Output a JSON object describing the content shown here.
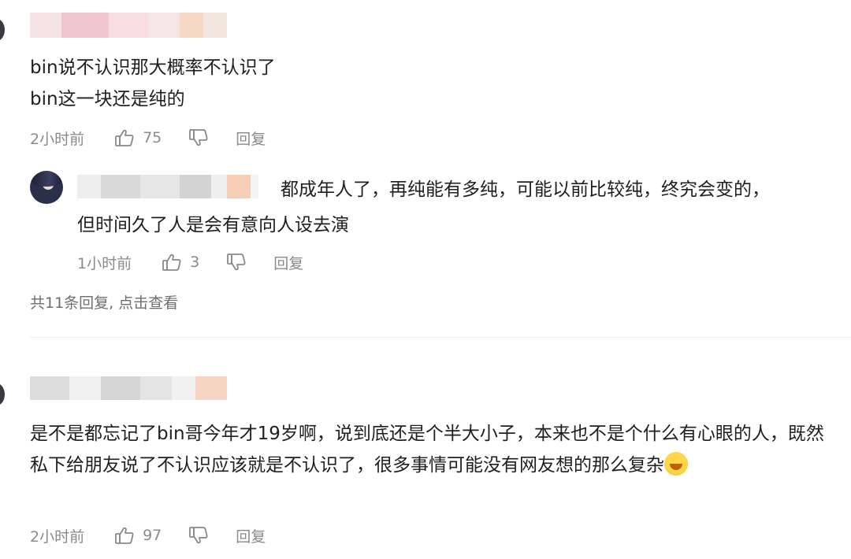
{
  "comments": [
    {
      "lines": [
        "bin说不认识那大概率不认识了",
        "bin这一块还是纯的"
      ],
      "time": "2小时前",
      "likes": "75",
      "reply_label": "回复"
    },
    {
      "text": "是不是都忘记了bin哥今年才19岁啊，说到底还是个半大小子，本来也不是个什么有心眼的人，既然私下给朋友说了不认识应该就是不认识了，很多事情可能没有网友想的那么复杂",
      "time": "2小时前",
      "likes": "97",
      "reply_label": "回复",
      "emoji": "laughing-crying-emoji"
    }
  ],
  "reply": {
    "lines": [
      "都成年人了，再纯能有多纯，可能以前比较纯，终究会变的，",
      "但时间久了人是会有意向人设去演"
    ],
    "time": "1小时前",
    "likes": "3",
    "reply_label": "回复"
  },
  "view_replies": "共11条回复, 点击查看",
  "icons": {
    "like": "thumb-up-icon",
    "dislike": "thumb-down-icon"
  }
}
